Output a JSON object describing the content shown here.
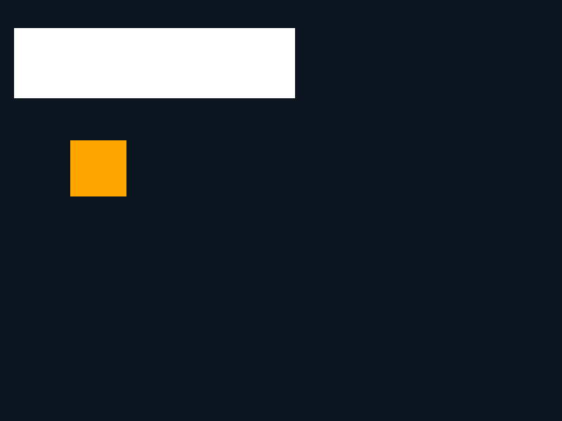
{
  "colors": {
    "background": "#0d1520",
    "bar": "#ffffff",
    "square": "#ffa500"
  }
}
